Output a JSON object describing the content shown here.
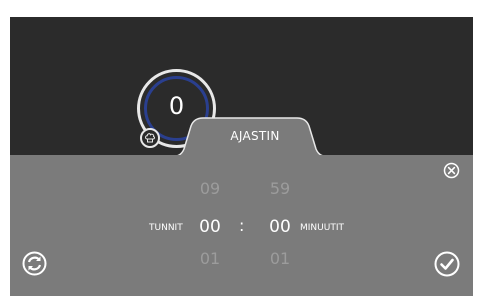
{
  "gauge": {
    "value": "0"
  },
  "tab": {
    "title": "AJASTIN"
  },
  "timer": {
    "hours_label": "TUNNIT",
    "minutes_label": "MINUUTIT",
    "separator": ":",
    "hours_prev": "09",
    "hours_current": "00",
    "hours_next": "01",
    "minutes_prev": "59",
    "minutes_current": "00",
    "minutes_next": "01"
  },
  "icons": {
    "close": "close-icon",
    "reset": "refresh-icon",
    "confirm": "checkmark-icon",
    "chef": "chef-hat-icon"
  },
  "colors": {
    "background": "#2b2b2b",
    "panel": "#7b7b7b",
    "ring": "#2a3f8f",
    "text": "#ffffff",
    "dim_text": "#9c9c9c"
  }
}
